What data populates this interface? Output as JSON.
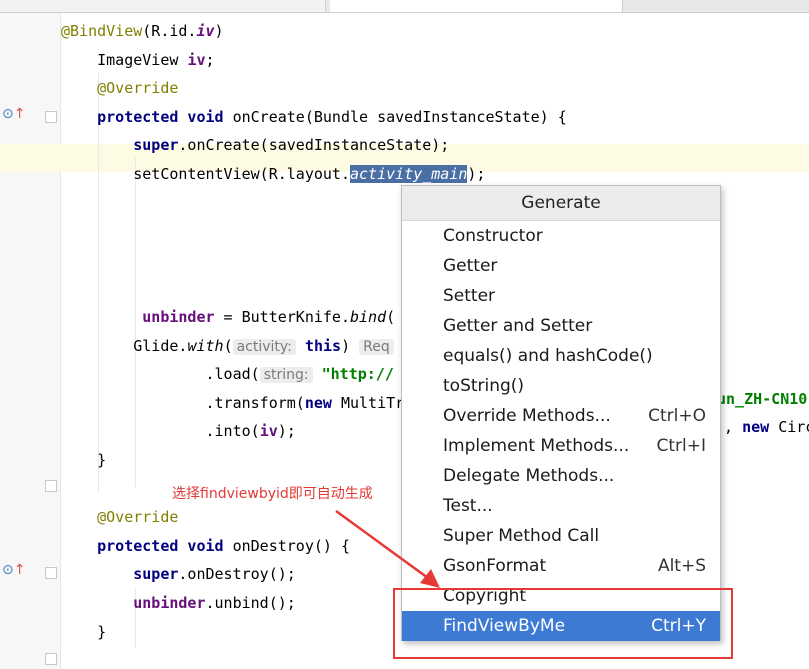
{
  "code_lines": [
    [
      {
        "t": "@BindView",
        "c": "ann"
      },
      {
        "t": "(R.id."
      },
      {
        "t": "iv",
        "c": "fld it"
      },
      {
        "t": ")"
      }
    ],
    [
      {
        "t": "    ImageView "
      },
      {
        "t": "iv",
        "c": "fld"
      },
      {
        "t": ";"
      }
    ],
    [
      {
        "t": "    "
      },
      {
        "t": "@Override",
        "c": "ann"
      }
    ],
    [
      {
        "t": "    "
      },
      {
        "t": "protected void",
        "c": "kw"
      },
      {
        "t": " onCreate(Bundle savedInstanceState) {"
      }
    ],
    [
      {
        "t": "        "
      },
      {
        "t": "super",
        "c": "kw"
      },
      {
        "t": ".onCreate(savedInstanceState);"
      }
    ],
    [
      {
        "t": "        setContentView(R.layout."
      },
      {
        "t": "activity_main",
        "c": "sel"
      },
      {
        "t": ");"
      }
    ],
    [],
    [],
    [],
    [],
    [
      {
        "t": "         "
      },
      {
        "t": "unbinder",
        "c": "fld"
      },
      {
        "t": " = ButterKnife."
      },
      {
        "t": "bind",
        "c": "it"
      },
      {
        "t": "("
      }
    ],
    [
      {
        "t": "        Glide."
      },
      {
        "t": "with",
        "c": "it"
      },
      {
        "t": "("
      },
      {
        "t": "activity:",
        "c": "hint"
      },
      {
        "t": " "
      },
      {
        "t": "this",
        "c": "kw"
      },
      {
        "t": ") "
      },
      {
        "t": "Req",
        "c": "hint"
      }
    ],
    [
      {
        "t": "                .load("
      },
      {
        "t": "string:",
        "c": "hint"
      },
      {
        "t": " "
      },
      {
        "t": "\"http://",
        "c": "str"
      }
    ],
    [
      {
        "t": "                .transform("
      },
      {
        "t": "new",
        "c": "kw"
      },
      {
        "t": " MultiTr"
      }
    ],
    [
      {
        "t": "                .into("
      },
      {
        "t": "iv",
        "c": "fld"
      },
      {
        "t": ");"
      }
    ],
    [
      {
        "t": "    }"
      }
    ],
    [],
    [
      {
        "t": "    "
      },
      {
        "t": "@Override",
        "c": "ann"
      }
    ],
    [
      {
        "t": "    "
      },
      {
        "t": "protected void",
        "c": "kw"
      },
      {
        "t": " onDestroy() {"
      }
    ],
    [
      {
        "t": "        "
      },
      {
        "t": "super",
        "c": "kw"
      },
      {
        "t": ".onDestroy();"
      }
    ],
    [
      {
        "t": "        "
      },
      {
        "t": "unbinder",
        "c": "fld"
      },
      {
        "t": ".unbind();"
      }
    ],
    [
      {
        "t": "    }"
      }
    ]
  ],
  "right_fragments": {
    "load_tail": "un_ZH-CN10",
    "transform_tail_paren": "),",
    "transform_tail_new": "new",
    "transform_tail_rest": " Circ"
  },
  "menu": {
    "title": "Generate",
    "items": [
      {
        "label": "Constructor",
        "shortcut": ""
      },
      {
        "label": "Getter",
        "shortcut": ""
      },
      {
        "label": "Setter",
        "shortcut": ""
      },
      {
        "label": "Getter and Setter",
        "shortcut": ""
      },
      {
        "label": "equals() and hashCode()",
        "shortcut": ""
      },
      {
        "label": "toString()",
        "shortcut": ""
      },
      {
        "label": "Override Methods...",
        "shortcut": "Ctrl+O"
      },
      {
        "label": "Implement Methods...",
        "shortcut": "Ctrl+I"
      },
      {
        "label": "Delegate Methods...",
        "shortcut": ""
      },
      {
        "label": "Test...",
        "shortcut": ""
      },
      {
        "label": "Super Method Call",
        "shortcut": ""
      },
      {
        "label": "GsonFormat",
        "shortcut": "Alt+S"
      },
      {
        "label": "Copyright",
        "shortcut": ""
      },
      {
        "label": "FindViewByMe",
        "shortcut": "Ctrl+Y"
      }
    ],
    "active_index": 13
  },
  "annotation": {
    "note": "选择findviewbyid即可自动生成",
    "color": "#e53935"
  },
  "colors": {
    "selection": "#4a6fa5",
    "menu_active": "#3d7ad4",
    "current_line": "#fdfbe3"
  }
}
